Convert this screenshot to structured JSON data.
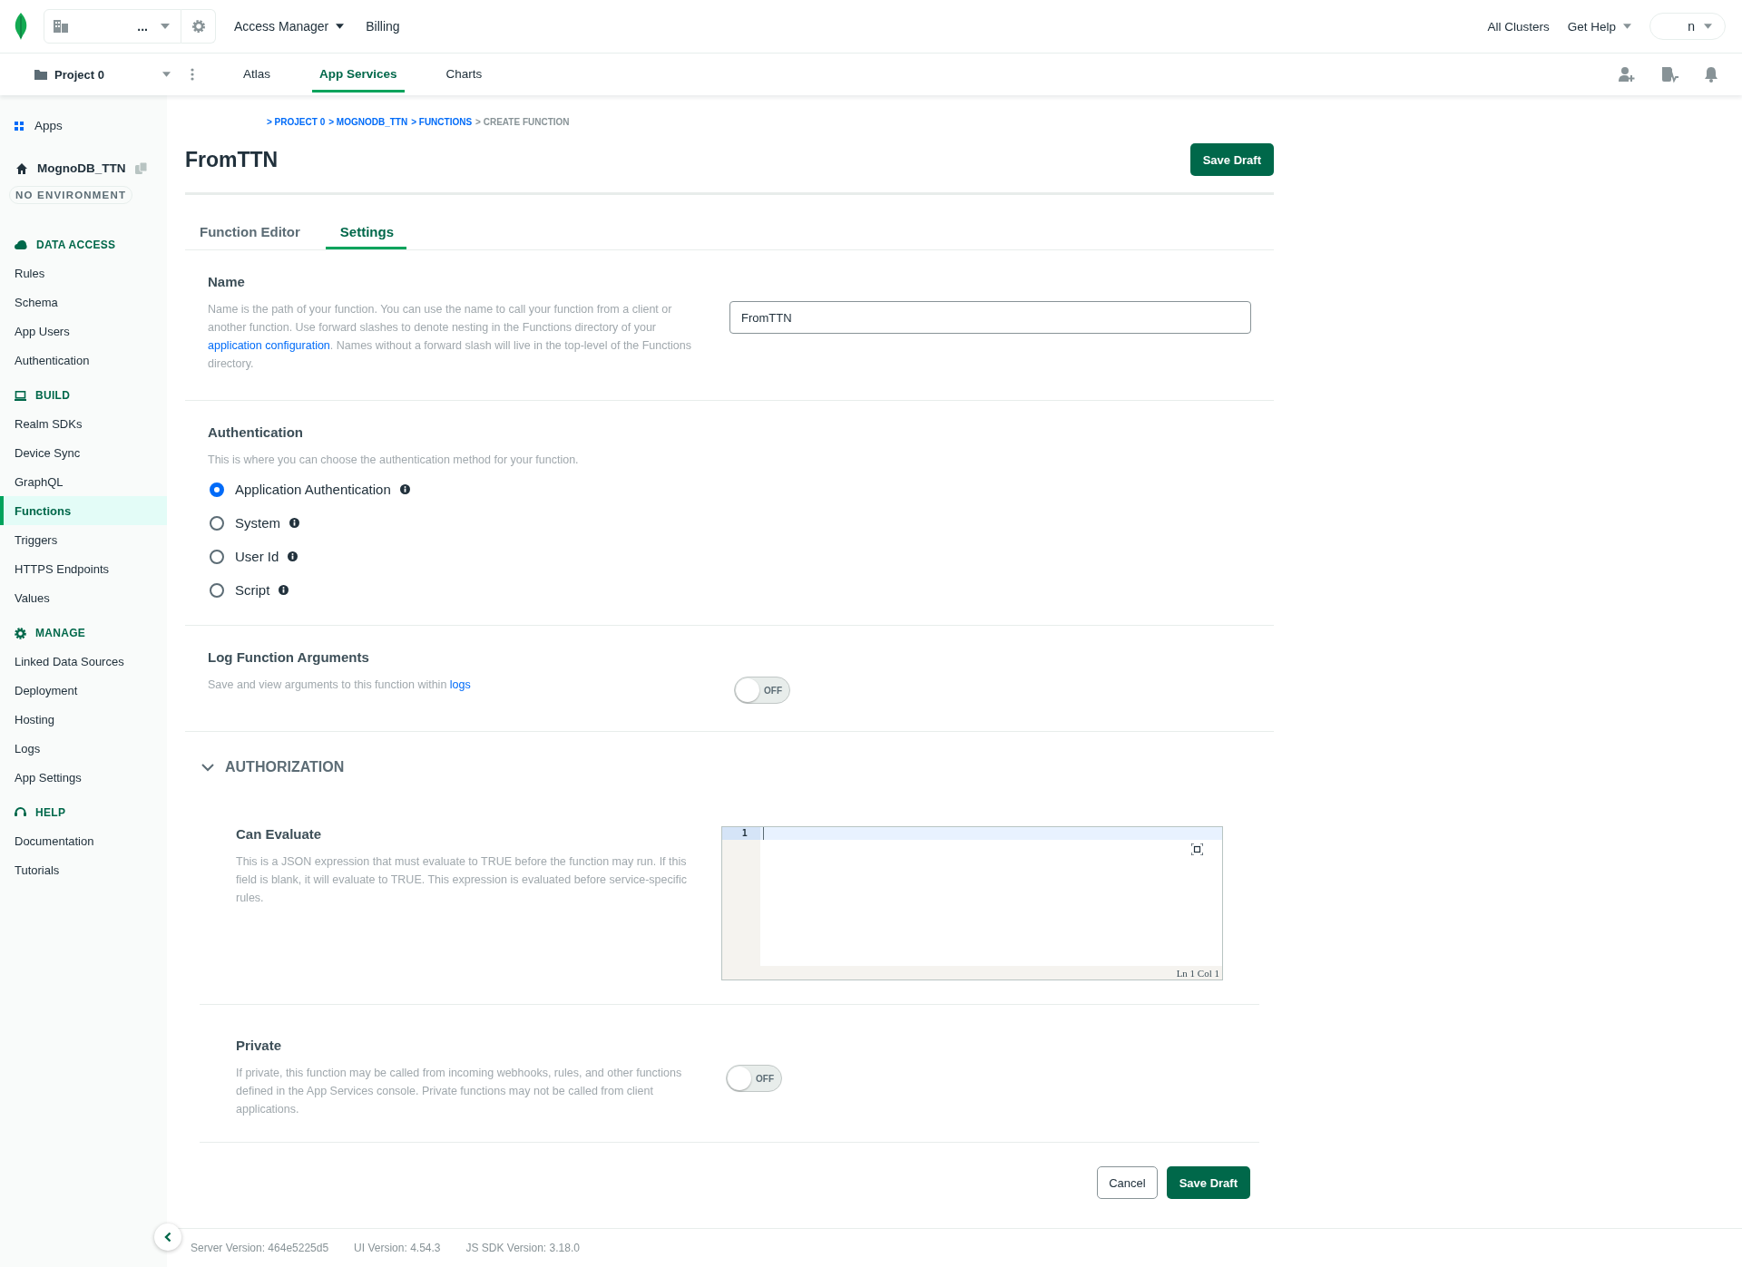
{
  "top_bar": {
    "org_selector": {
      "value": "..."
    },
    "menus": [
      {
        "label": "Access Manager",
        "dropdown": true
      },
      {
        "label": "Billing",
        "dropdown": false
      }
    ],
    "right_links": [
      {
        "label": "All Clusters",
        "dropdown": false
      },
      {
        "label": "Get Help",
        "dropdown": true
      }
    ],
    "user_menu": {
      "label": "n"
    }
  },
  "project_bar": {
    "project": "Project 0",
    "tabs": [
      {
        "label": "Atlas",
        "selected": false
      },
      {
        "label": "App Services",
        "selected": true
      },
      {
        "label": "Charts",
        "selected": false
      }
    ]
  },
  "sidebar": {
    "apps_link": "Apps",
    "app_name": "MognoDB_TTN",
    "environment": "NO ENVIRONMENT",
    "sections": [
      {
        "title": "DATA ACCESS",
        "items": [
          {
            "label": "Rules",
            "selected": false
          },
          {
            "label": "Schema",
            "selected": false
          },
          {
            "label": "App Users",
            "selected": false
          },
          {
            "label": "Authentication",
            "selected": false
          }
        ]
      },
      {
        "title": "BUILD",
        "items": [
          {
            "label": "Realm SDKs",
            "selected": false
          },
          {
            "label": "Device Sync",
            "selected": false
          },
          {
            "label": "GraphQL",
            "selected": false
          },
          {
            "label": "Functions",
            "selected": true
          },
          {
            "label": "Triggers",
            "selected": false
          },
          {
            "label": "HTTPS Endpoints",
            "selected": false
          },
          {
            "label": "Values",
            "selected": false
          }
        ]
      },
      {
        "title": "MANAGE",
        "items": [
          {
            "label": "Linked Data Sources",
            "selected": false
          },
          {
            "label": "Deployment",
            "selected": false
          },
          {
            "label": "Hosting",
            "selected": false
          },
          {
            "label": "Logs",
            "selected": false
          },
          {
            "label": "App Settings",
            "selected": false
          }
        ]
      },
      {
        "title": "HELP",
        "items": [
          {
            "label": "Documentation",
            "selected": false
          },
          {
            "label": "Tutorials",
            "selected": false
          }
        ]
      }
    ]
  },
  "breadcrumb": [
    {
      "label": "> PROJECT 0",
      "link": true
    },
    {
      "label": "> MOGNODB_TTN",
      "link": true
    },
    {
      "label": "> FUNCTIONS",
      "link": true
    },
    {
      "label": "> CREATE FUNCTION",
      "link": false
    }
  ],
  "page_title": "FromTTN",
  "header_button": "Save Draft",
  "tabs": [
    {
      "label": "Function Editor",
      "selected": false
    },
    {
      "label": "Settings",
      "selected": true
    }
  ],
  "name_section": {
    "title": "Name",
    "description_before": "Name is the path of your function. You can use the name to call your function from a client or another function. Use forward slashes to denote nesting in the Functions directory of your ",
    "description_link": "application configuration",
    "description_after": ". Names without a forward slash will live in the top-level of the Functions directory.",
    "value": "FromTTN"
  },
  "authentication": {
    "title": "Authentication",
    "description": "This is where you can choose the authentication method for your function.",
    "options": [
      {
        "label": "Application Authentication",
        "selected": true
      },
      {
        "label": "System",
        "selected": false
      },
      {
        "label": "User Id",
        "selected": false
      },
      {
        "label": "Script",
        "selected": false
      }
    ]
  },
  "log_arguments": {
    "title": "Log Function Arguments",
    "description_before": "Save and view arguments to this function within ",
    "description_link": "logs",
    "toggle": {
      "on": false,
      "label": "OFF"
    }
  },
  "authorization": {
    "title": "AUTHORIZATION",
    "expanded": true,
    "can_evaluate": {
      "title": "Can Evaluate",
      "description": "This is a JSON expression that must evaluate to TRUE before the function may run. If this field is blank, it will evaluate to TRUE. This expression is evaluated before service-specific rules.",
      "line_number": "1",
      "status": "Ln 1 Col 1"
    },
    "private": {
      "title": "Private",
      "description": "If private, this function may be called from incoming webhooks, rules, and other functions defined in the App Services console. Private functions may not be called from client applications.",
      "toggle": {
        "on": false,
        "label": "OFF"
      }
    }
  },
  "footer_buttons": [
    {
      "label": "Cancel",
      "kind": "secondary"
    },
    {
      "label": "Save Draft",
      "kind": "primary"
    }
  ],
  "versions": [
    "Server Version: 464e5225d5",
    "UI Version: 4.54.3",
    "JS SDK Version: 3.18.0"
  ]
}
